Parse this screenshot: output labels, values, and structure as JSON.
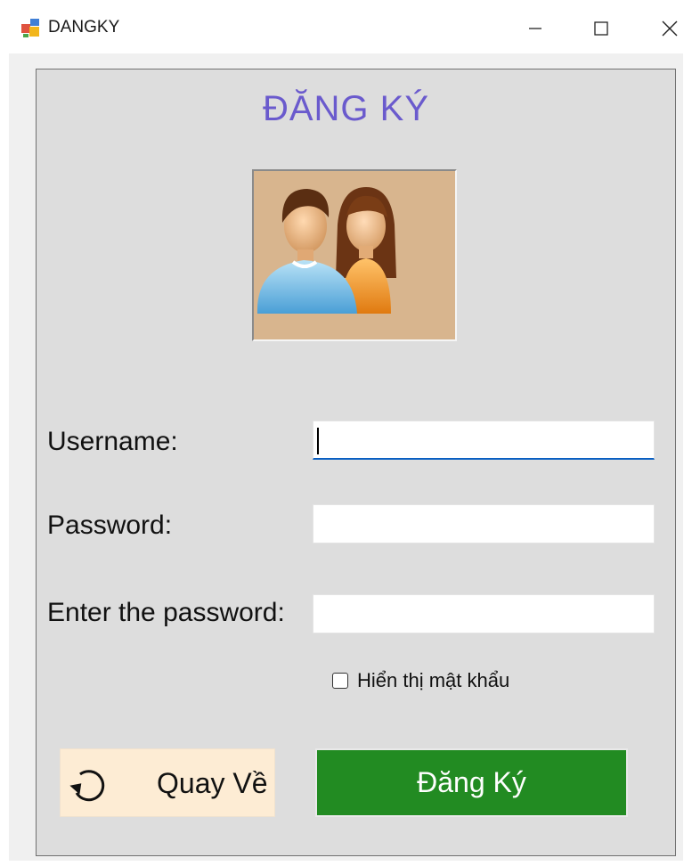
{
  "window": {
    "title": "DANGKY",
    "icon": "winforms-app-icon"
  },
  "form": {
    "heading": "ĐĂNG KÝ",
    "heading_color": "#6A5ACD",
    "avatar_image": "users-avatar-icon",
    "fields": [
      {
        "label": "Username:",
        "value": "",
        "focused": true
      },
      {
        "label": "Password:",
        "value": ""
      },
      {
        "label": "Enter the password:",
        "value": ""
      }
    ],
    "show_password": {
      "label": "Hiển thị mật khẩu",
      "checked": false
    },
    "back_button": {
      "label": "Quay Về",
      "icon": "undo-icon",
      "bg": "#FDECD4"
    },
    "register_button": {
      "label": "Đăng Ký",
      "bg": "#228B22"
    }
  }
}
